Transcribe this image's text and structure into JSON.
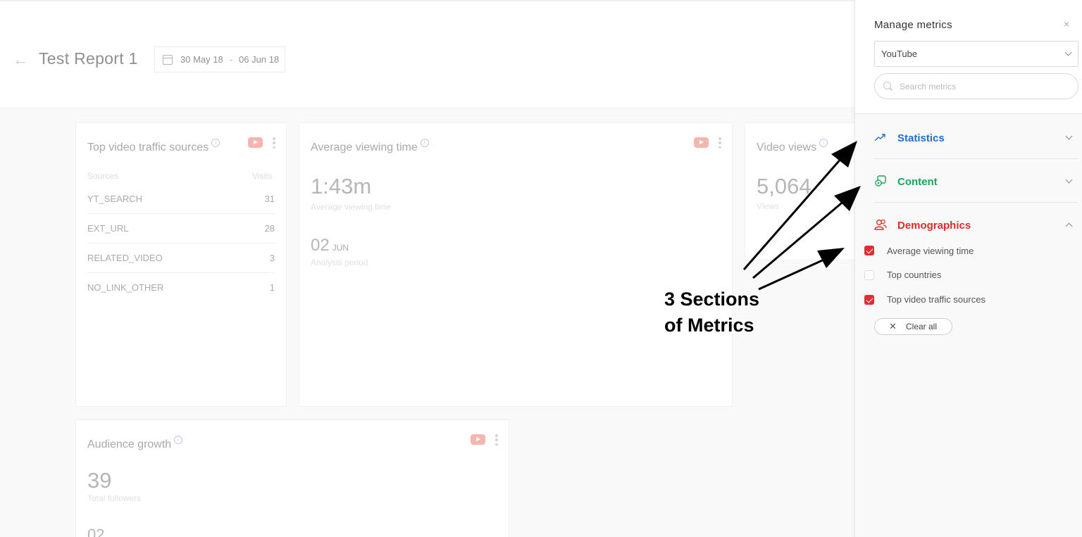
{
  "report": {
    "title": "Test Report 1",
    "date_start": "30 May 18",
    "date_sep": "-",
    "date_end": "06 Jun 18"
  },
  "cards": {
    "traffic": {
      "title": "Top video traffic sources",
      "col_sources": "Sources",
      "col_visits": "Visits",
      "rows": [
        {
          "source": "YT_SEARCH",
          "visits": "31"
        },
        {
          "source": "EXT_URL",
          "visits": "28"
        },
        {
          "source": "RELATED_VIDEO",
          "visits": "3"
        },
        {
          "source": "NO_LINK_OTHER",
          "visits": "1"
        }
      ]
    },
    "avg_viewing": {
      "title": "Average viewing time",
      "value": "1:43m",
      "value_label": "Average viewing time",
      "period_day": "02",
      "period_month": "JUN",
      "period_label": "Analysis period"
    },
    "video_views": {
      "title": "Video views",
      "value": "5,064",
      "value_label": "Views"
    },
    "audience": {
      "title": "Audience growth",
      "value": "39",
      "value_label": "Total followers",
      "next_value": "02"
    }
  },
  "panel": {
    "title": "Manage metrics",
    "close": "×",
    "network_selected": "YouTube",
    "search_placeholder": "Search metrics",
    "sections": [
      {
        "label": "Statistics",
        "color": "#1f6fd1",
        "icon": "trend-up-icon",
        "expanded": false
      },
      {
        "label": "Content",
        "color": "#1aa35c",
        "icon": "content-icon",
        "expanded": false
      },
      {
        "label": "Demographics",
        "color": "#e02b2b",
        "icon": "users-icon",
        "expanded": true
      }
    ],
    "metrics": [
      {
        "label": "Average viewing time",
        "checked": true
      },
      {
        "label": "Top countries",
        "checked": false
      },
      {
        "label": "Top video traffic sources",
        "checked": true
      }
    ],
    "clear_all": "Clear all"
  },
  "annotation": {
    "line1": "3 Sections",
    "line2": "of Metrics"
  }
}
